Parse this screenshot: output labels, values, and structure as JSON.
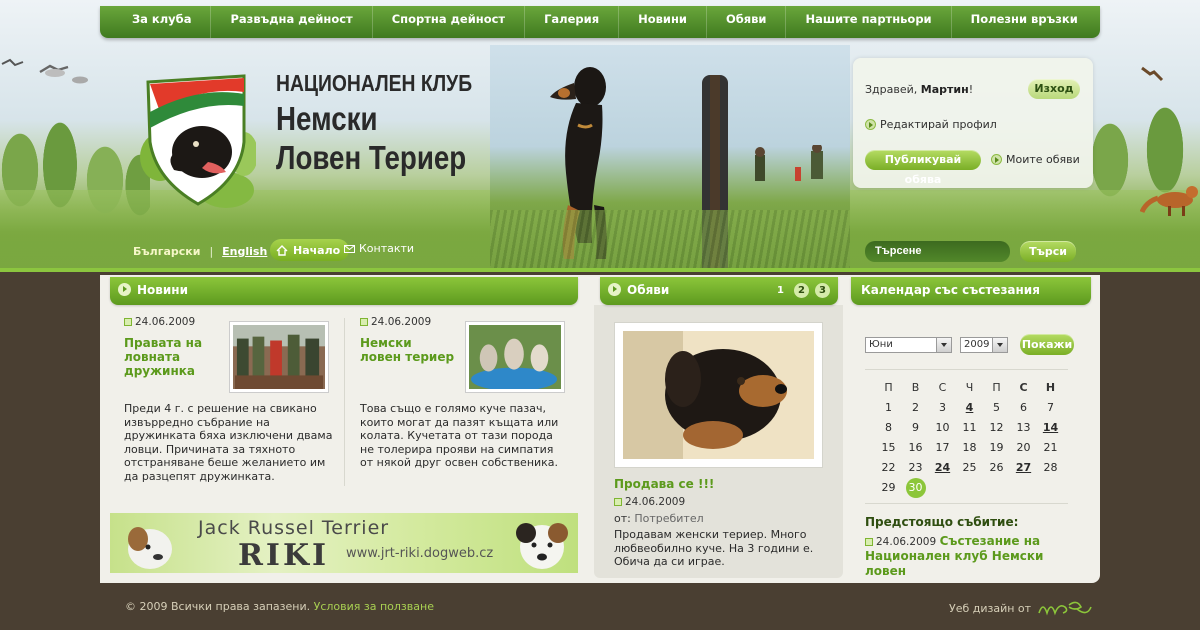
{
  "nav": {
    "items": [
      {
        "label": "За клуба"
      },
      {
        "label": "Развъдна дейност"
      },
      {
        "label": "Спортна дейност"
      },
      {
        "label": "Галерия"
      },
      {
        "label": "Новини"
      },
      {
        "label": "Обяви"
      },
      {
        "label": "Нашите партньори"
      },
      {
        "label": "Полезни връзки"
      }
    ]
  },
  "logo": {
    "line1": "НАЦИОНАЛЕН КЛУБ",
    "line2": "Немски",
    "line3": "Ловен Териер"
  },
  "lang": {
    "bg": "Български",
    "sep": "|",
    "en": "English"
  },
  "subnav": {
    "home": "Начало",
    "contacts": "Контакти"
  },
  "user": {
    "greeting_prefix": "Здравей, ",
    "name": "Мартин",
    "greeting_suffix": "!",
    "logout": "Изход",
    "edit_profile": "Редактирай профил",
    "publish": "Публикувай обява",
    "my_ads": "Моите обяви"
  },
  "search": {
    "value": "Търсене",
    "button": "Търси"
  },
  "news": {
    "heading": "Новини",
    "items": [
      {
        "date": "24.06.2009",
        "title": "Правата на ловната дружинка",
        "body": "Преди 4 г. с решение на свикано извърредно събрание на дружинката бяха изключени двама ловци. Причината за тяхното отстраняване беше желанието им да разцепят дружинката."
      },
      {
        "date": "24.06.2009",
        "title": "Немски ловен териер",
        "body": "Това също е голямо куче пазач, които могат да пазят къщата или колата. Кучетата от тази порода не толерира прояви на симпатия от някой друг освен собственика."
      }
    ]
  },
  "banner": {
    "line1": "Jack Russel Terrier",
    "line2": "RIKI",
    "url": "www.jrt-riki.dogweb.cz"
  },
  "ads": {
    "heading": "Обяви",
    "pages": [
      "1",
      "2",
      "3"
    ],
    "current_page": "1",
    "item": {
      "title": "Продава се !!!",
      "date": "24.06.2009",
      "from_label": "от:",
      "from_value": "Потребител",
      "body": "Продавам женски териер. Много любвеобилно куче. На 3 години е. Обича да си играе."
    }
  },
  "calendar": {
    "heading": "Календар със състезания",
    "month": "Юни",
    "year": "2009",
    "show_button": "Покажи",
    "weekdays": [
      "П",
      "В",
      "С",
      "Ч",
      "П",
      "С",
      "Н"
    ],
    "weeks": [
      [
        "1",
        "2",
        "3",
        "4",
        "5",
        "6",
        "7"
      ],
      [
        "8",
        "9",
        "10",
        "11",
        "12",
        "13",
        "14"
      ],
      [
        "15",
        "16",
        "17",
        "18",
        "19",
        "20",
        "21"
      ],
      [
        "22",
        "23",
        "24",
        "25",
        "26",
        "27",
        "28"
      ],
      [
        "29",
        "30",
        "",
        "",
        "",
        "",
        ""
      ]
    ],
    "event_days": [
      "4",
      "14",
      "24",
      "27"
    ],
    "today": "30",
    "upcoming_label": "Предстоящо събитие:",
    "upcoming_date": "24.06.2009",
    "upcoming_title": "Състезание на Национален клуб Немски ловен"
  },
  "footer": {
    "copyright": "© 2009 Всички права запазени.",
    "terms": "Условия за ползване",
    "design_by": "Уеб дизайн от"
  },
  "colors": {
    "accent_green": "#8cc63a",
    "dark_green": "#3f7a1f",
    "link_green": "#5c9a1c",
    "footer_brown": "#4a3f32"
  }
}
